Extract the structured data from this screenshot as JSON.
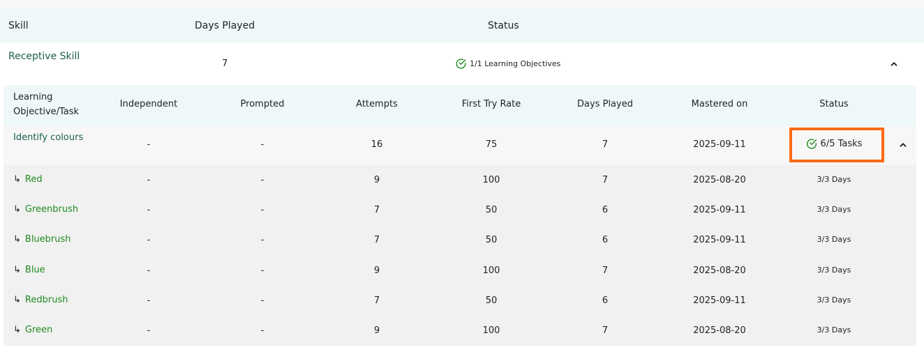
{
  "skill_table": {
    "headers": {
      "skill": "Skill",
      "days_played": "Days Played",
      "status": "Status"
    },
    "row": {
      "name": "Receptive Skill",
      "days_played": "7",
      "status": "1/1 Learning Objectives"
    }
  },
  "objectives_table": {
    "headers": {
      "learning_objective": "Learning Objective/Task",
      "independent": "Independent",
      "prompted": "Prompted",
      "attempts": "Attempts",
      "first_try_rate": "First Try Rate",
      "days_played": "Days Played",
      "mastered_on": "Mastered on",
      "status": "Status"
    },
    "objective": {
      "name": "Identify colours",
      "independent": "-",
      "prompted": "-",
      "attempts": "16",
      "first_try_rate": "75",
      "days_played": "7",
      "mastered_on": "2025-09-11",
      "status": "6/5 Tasks"
    },
    "tasks": [
      {
        "name": "Red",
        "independent": "-",
        "prompted": "-",
        "attempts": "9",
        "first_try_rate": "100",
        "days_played": "7",
        "mastered_on": "2025-08-20",
        "status": "3/3 Days"
      },
      {
        "name": "Greenbrush",
        "independent": "-",
        "prompted": "-",
        "attempts": "7",
        "first_try_rate": "50",
        "days_played": "6",
        "mastered_on": "2025-09-11",
        "status": "3/3 Days"
      },
      {
        "name": "Bluebrush",
        "independent": "-",
        "prompted": "-",
        "attempts": "7",
        "first_try_rate": "50",
        "days_played": "6",
        "mastered_on": "2025-09-11",
        "status": "3/3 Days"
      },
      {
        "name": "Blue",
        "independent": "-",
        "prompted": "-",
        "attempts": "9",
        "first_try_rate": "100",
        "days_played": "7",
        "mastered_on": "2025-08-20",
        "status": "3/3 Days"
      },
      {
        "name": "Redbrush",
        "independent": "-",
        "prompted": "-",
        "attempts": "7",
        "first_try_rate": "50",
        "days_played": "6",
        "mastered_on": "2025-09-11",
        "status": "3/3 Days"
      },
      {
        "name": "Green",
        "independent": "-",
        "prompted": "-",
        "attempts": "9",
        "first_try_rate": "100",
        "days_played": "7",
        "mastered_on": "2025-08-20",
        "status": "3/3 Days"
      }
    ]
  },
  "icons": {
    "check": "check-circle-icon",
    "collapse": "chevron-up-icon",
    "subtask": "subdirectory-arrow-icon"
  },
  "colors": {
    "accent_green": "#1f8a1f",
    "skill_teal": "#1b5e52",
    "header_bg": "#eef8f8",
    "highlight": "#ff6a13"
  }
}
